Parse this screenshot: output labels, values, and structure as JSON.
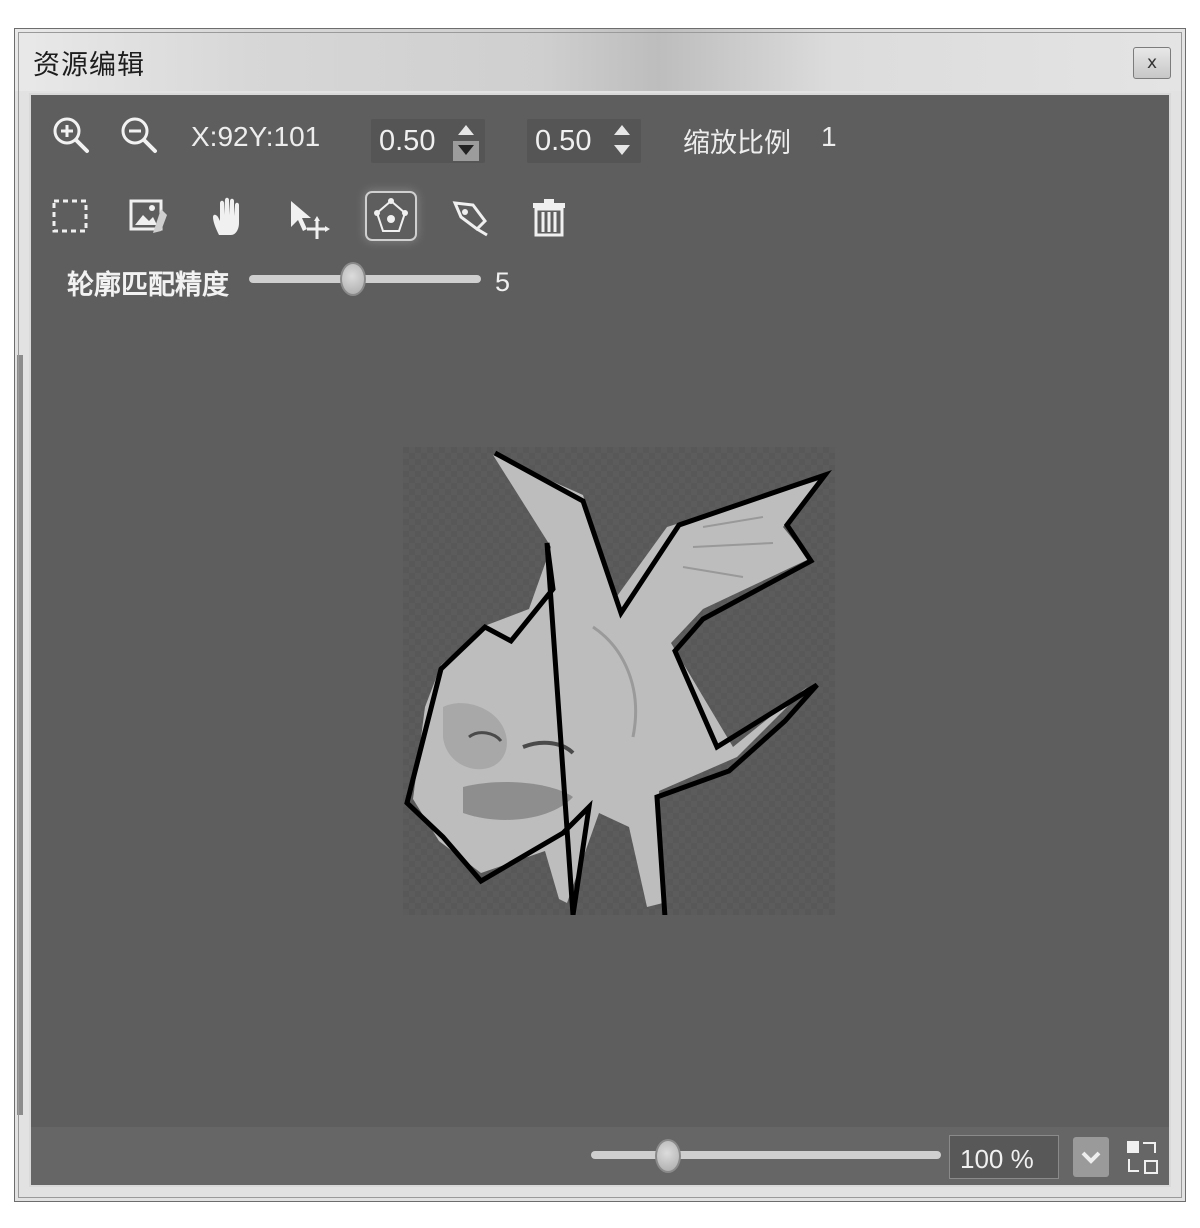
{
  "window": {
    "title": "资源编辑",
    "close_label": "x"
  },
  "toolbar": {
    "coords": "X:92Y:101",
    "spin1_value": "0.50",
    "spin2_value": "0.50",
    "zoom_label": "缩放比例",
    "zoom_value": "1",
    "tools": [
      "rect-select-icon",
      "image-edit-icon",
      "hand-icon",
      "move-arrow-icon",
      "contour-icon",
      "pen-icon",
      "trash-icon"
    ],
    "active_tool": "contour-icon"
  },
  "precision": {
    "label": "轮廓匹配精度",
    "value": "5",
    "level_fraction": 0.45
  },
  "bottom": {
    "zoom_percent": "100 %",
    "zoom_slider_fraction": 0.22
  },
  "colors": {
    "panel_bg": "#5e5e5e",
    "contour_stroke": "#000000",
    "sprite_fill": "#bdbdbd"
  }
}
